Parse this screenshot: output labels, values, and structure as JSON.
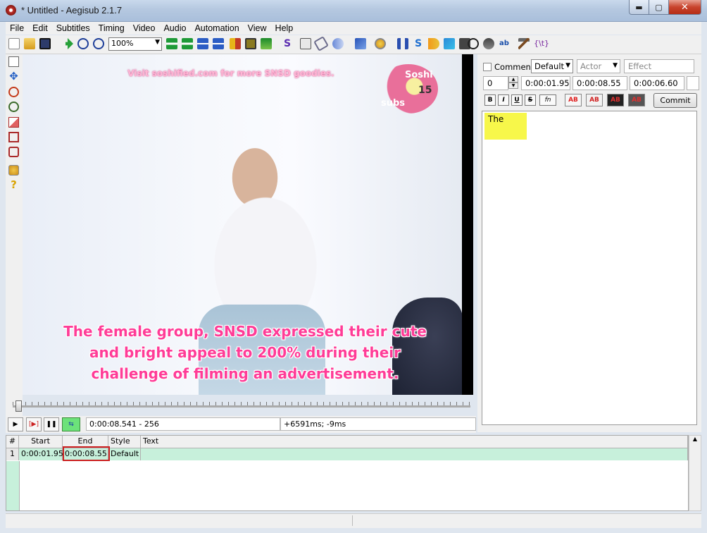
{
  "window": {
    "title": "* Untitled - Aegisub 2.1.7",
    "min_glyph": "▬",
    "max_glyph": "▢",
    "close_glyph": "✕"
  },
  "menu": [
    "File",
    "Edit",
    "Subtitles",
    "Timing",
    "Video",
    "Audio",
    "Automation",
    "View",
    "Help"
  ],
  "toolbar": {
    "zoom_value": "100%",
    "icons": [
      "new-file-icon",
      "open-file-icon",
      "save-icon",
      "jump-to-icon",
      "zoom-in-icon",
      "zoom-out-icon",
      "jump-video-to-start-icon",
      "jump-video-to-end-icon",
      "set-start-to-video-icon",
      "set-end-to-video-icon",
      "snap-to-keyframe-icon",
      "video-snap-icon",
      "styles-manager-icon",
      "properties-icon",
      "attachments-icon",
      "fonts-collector-icon",
      "automation-icon",
      "resample-icon",
      "timing-postprocessor-icon",
      "kanji-timer-icon",
      "spell-checker-icon",
      "translation-assistant-icon",
      "options-icon"
    ]
  },
  "video": {
    "watermark": "Visit soshified.com for more SNSD goodies.",
    "logo_top": "Soshi",
    "logo_bottom": "subs",
    "logo_number": "15",
    "subtitle_line1": "The female group, SNSD expressed their cute",
    "subtitle_line2": "and bright appeal to 200% during their",
    "subtitle_line3": "challenge of filming an advertisement."
  },
  "playback": {
    "time_readout": "0:00:08.541 - 256",
    "offset_readout": "+6591ms; -9ms"
  },
  "edit": {
    "comment_label": "Comment",
    "style_value": "Default",
    "actor_placeholder": "Actor",
    "effect_placeholder": "Effect",
    "layer": "0",
    "start_time": "0:00:01.95",
    "end_time": "0:00:08.55",
    "duration": "0:00:06.60",
    "bold": "B",
    "italic": "I",
    "underline": "U",
    "strike": "S",
    "font": "fn",
    "color_label": "AB",
    "commit_label": "Commit",
    "text": "The"
  },
  "grid": {
    "headers": {
      "num": "#",
      "start": "Start",
      "end": "End",
      "style": "Style",
      "text": "Text"
    },
    "rows": [
      {
        "num": "1",
        "start": "0:00:01.95",
        "end": "0:00:08.55",
        "style": "Default",
        "text": ""
      }
    ]
  }
}
